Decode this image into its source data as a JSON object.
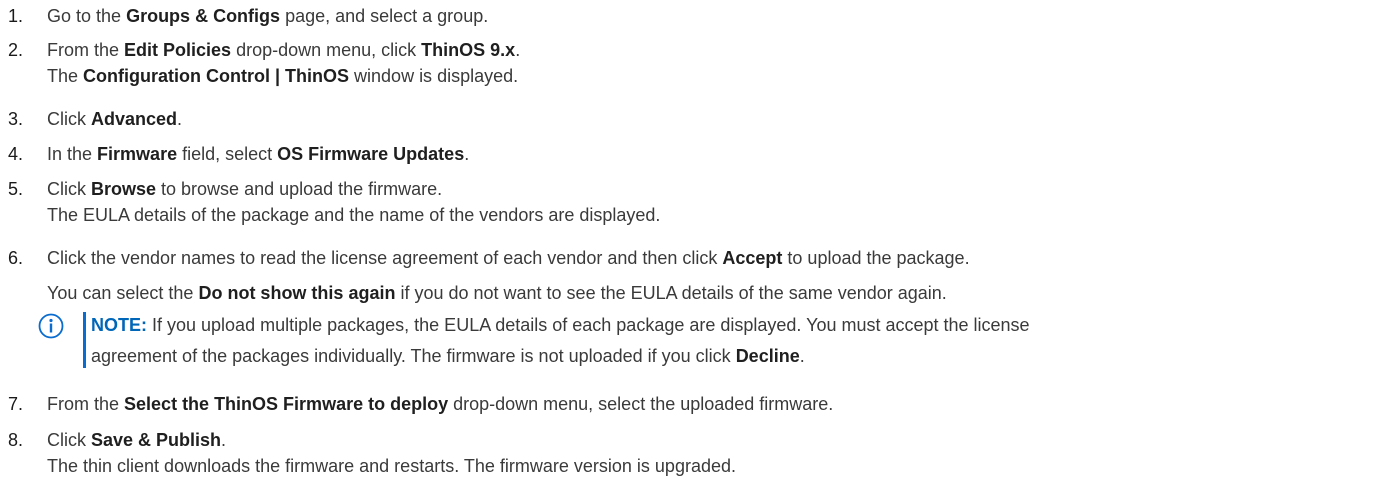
{
  "steps": [
    {
      "number": "1.",
      "lines": [
        [
          "Go to the ",
          "Groups & Configs",
          " page, and select a group.",
          "",
          ""
        ]
      ]
    },
    {
      "number": "2.",
      "lines": [
        [
          "From the ",
          "Edit Policies",
          " drop-down menu, click ",
          "ThinOS 9.x",
          "."
        ],
        [
          "The ",
          "Configuration Control | ThinOS",
          " window is displayed.",
          "",
          ""
        ]
      ]
    },
    {
      "number": "3.",
      "lines": [
        [
          "Click ",
          "Advanced",
          ".",
          "",
          ""
        ]
      ]
    },
    {
      "number": "4.",
      "lines": [
        [
          "In the ",
          "Firmware",
          " field, select ",
          "OS Firmware Updates",
          "."
        ]
      ]
    },
    {
      "number": "5.",
      "lines": [
        [
          "Click ",
          "Browse",
          " to browse and upload the firmware.",
          "",
          ""
        ],
        [
          "The EULA details of the package and the name of the vendors are displayed.",
          "",
          "",
          "",
          ""
        ]
      ]
    },
    {
      "number": "6.",
      "lines": [
        [
          "Click the vendor names to read the license agreement of each vendor and then click ",
          "Accept",
          " to upload the package.",
          "",
          ""
        ],
        [
          "You can select the ",
          "Do not show this again",
          " if you do not want to see the EULA details of the same vendor again.",
          "",
          ""
        ]
      ]
    },
    {
      "number": "7.",
      "lines": [
        [
          "From the ",
          "Select the ThinOS Firmware to deploy",
          " drop-down menu, select the uploaded firmware.",
          "",
          ""
        ]
      ]
    },
    {
      "number": "8.",
      "lines": [
        [
          "Click ",
          "Save & Publish",
          ".",
          "",
          ""
        ],
        [
          "The thin client downloads the firmware and restarts. The firmware version is upgraded.",
          "",
          "",
          "",
          ""
        ]
      ]
    }
  ],
  "note": {
    "label": "NOTE:",
    "line1": " If you upload multiple packages, the EULA details of each package are displayed. You must accept the license",
    "line2_pre": "agreement of the packages individually. The firmware is not uploaded if you click ",
    "line2_bold": "Decline",
    "line2_post": ".",
    "icon": "info-icon",
    "accent_color": "#0a6ccf"
  }
}
